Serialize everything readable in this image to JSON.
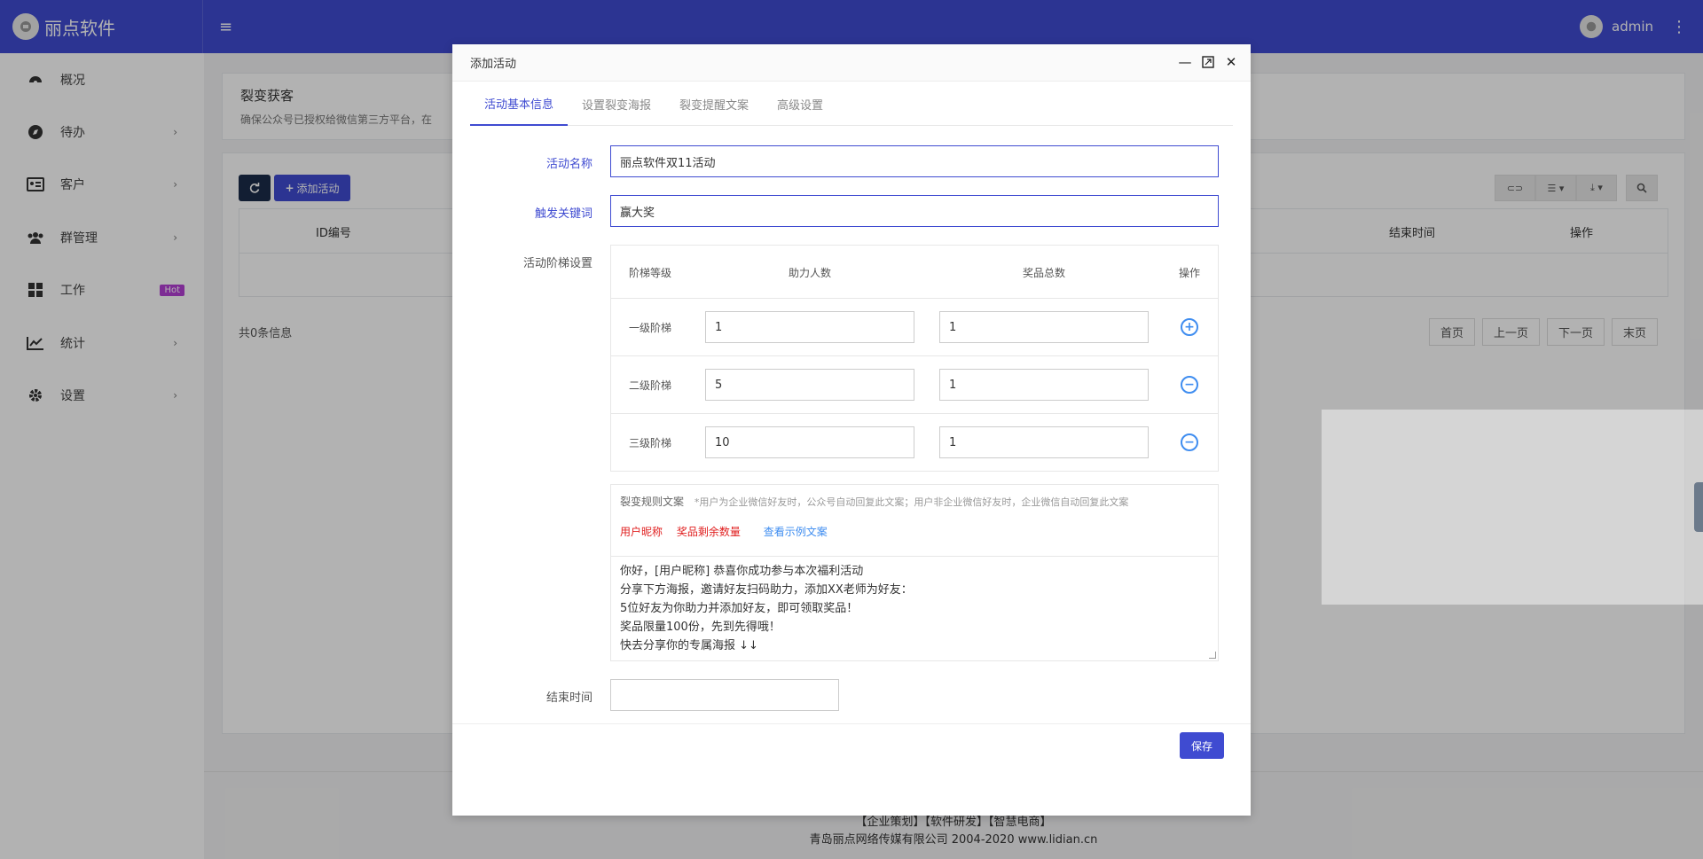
{
  "app": {
    "brand": "丽点软件",
    "user": "admin"
  },
  "sidebar": {
    "items": [
      {
        "label": "概况"
      },
      {
        "label": "待办",
        "chevron": "›"
      },
      {
        "label": "客户",
        "chevron": "›"
      },
      {
        "label": "群管理",
        "chevron": "›"
      },
      {
        "label": "工作",
        "badge": "Hot"
      },
      {
        "label": "统计",
        "chevron": "›"
      },
      {
        "label": "设置",
        "chevron": "›"
      }
    ]
  },
  "page": {
    "title": "裂变获客",
    "subtitle": "确保公众号已授权给微信第三方平台，在",
    "add_button": "添加活动",
    "table_headers": {
      "id": "ID编号",
      "end_time": "结束时间",
      "actions": "操作"
    },
    "records": "共0条信息",
    "pager": [
      "首页",
      "上一页",
      "下一页",
      "末页"
    ],
    "footer_links": "【企业策划】【软件研发】【智慧电商】",
    "copyright": "青岛丽点网络传媒有限公司 2004-2020 www.lidian.cn"
  },
  "modal": {
    "title": "添加活动",
    "tabs": [
      "活动基本信息",
      "设置裂变海报",
      "裂变提醒文案",
      "高级设置"
    ],
    "fields": {
      "activity_name_label": "活动名称",
      "activity_name": "丽点软件双11活动",
      "keyword_label": "触发关键词",
      "keyword": "赢大奖",
      "ladder_label": "活动阶梯设置",
      "end_time_label": "结束时间",
      "end_time": ""
    },
    "ladder": {
      "headers": [
        "阶梯等级",
        "助力人数",
        "奖品总数",
        "操作"
      ],
      "rows": [
        {
          "level": "一级阶梯",
          "helpers": "1",
          "prizes": "1",
          "action": "+"
        },
        {
          "level": "二级阶梯",
          "helpers": "5",
          "prizes": "1",
          "action": "−"
        },
        {
          "level": "三级阶梯",
          "helpers": "10",
          "prizes": "1",
          "action": "−"
        }
      ]
    },
    "rule": {
      "label": "裂变规则文案",
      "note": "*用户为企业微信好友时，公众号自动回复此文案；用户非企业微信好友时，企业微信自动回复此文案",
      "tag_nickname": "用户昵称",
      "tag_remaining": "奖品剩余数量",
      "example_link": "查看示例文案",
      "lines": [
        "你好，[用户昵称] 恭喜你成功参与本次福利活动",
        "分享下方海报，邀请好友扫码助力，添加XX老师为好友：",
        "5位好友为你助力并添加好友，即可领取奖品！",
        "奖品限量100份，先到先得哦！",
        "快去分享你的专属海报 ↓↓"
      ]
    },
    "save": "保存"
  },
  "colors": {
    "primary": "#3f4bd1",
    "dark": "#1a2b49",
    "danger": "#e02020",
    "link": "#3f8df0",
    "badge": "#b43fd4"
  }
}
